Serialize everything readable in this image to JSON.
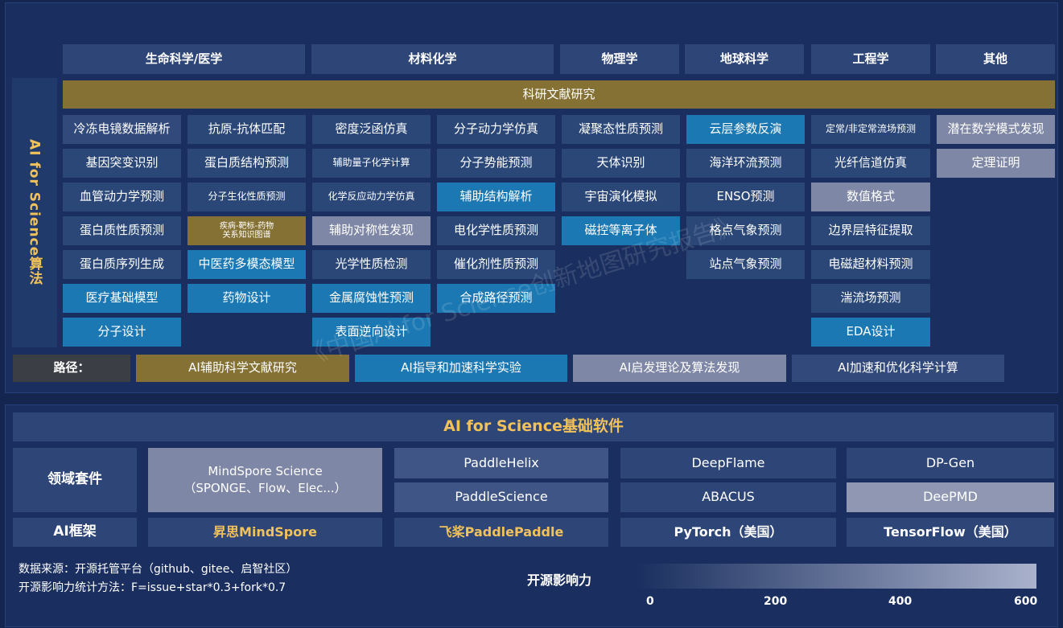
{
  "categories": [
    "生命科学/医学",
    "材料化学",
    "物理学",
    "地球科学",
    "工程学",
    "其他"
  ],
  "literature_bar": "科研文献研究",
  "side_label": "AI for Science算法",
  "grid": [
    [
      "冷冻电镜数据解析",
      "基因突变识别",
      "血管动力学预测",
      "蛋白质性质预测",
      "蛋白质序列生成",
      "医疗基础模型",
      "分子设计"
    ],
    [
      "抗原-抗体匹配",
      "蛋白质结构预测",
      "分子生化性质预测",
      "疾病-靶标-药物\n关系知识图谱",
      "中医药多模态模型",
      "药物设计"
    ],
    [
      "密度泛函仿真",
      "辅助量子化学计算",
      "化学反应动力学仿真",
      "辅助对称性发现",
      "光学性质检测",
      "金属腐蚀性预测",
      "表面逆向设计"
    ],
    [
      "分子动力学仿真",
      "分子势能预测",
      "辅助结构解析",
      "电化学性质预测",
      "催化剂性质预测",
      "合成路径预测"
    ],
    [
      "凝聚态性质预测",
      "天体识别",
      "宇宙演化模拟",
      "磁控等离子体"
    ],
    [
      "云层参数反演",
      "海洋环流预测",
      "ENSO预测",
      "格点气象预测",
      "站点气象预测"
    ],
    [
      "定常/非定常流场预测",
      "光纤信道仿真",
      "数值格式",
      "边界层特征提取",
      "电磁超材料预测",
      "湍流场预测",
      "EDA设计"
    ],
    [
      "潜在数学模式发现",
      "定理证明"
    ]
  ],
  "paths": {
    "label": "路径：",
    "items": [
      "AI辅助科学文献研究",
      "AI指导和加速科学实验",
      "AI启发理论及算法发现",
      "AI加速和优化科学计算"
    ]
  },
  "watermark": "《中国AI for Science创新地图研究报告》",
  "software": {
    "title": "AI for Science基础软件",
    "suite_label": "领域套件",
    "framework_label": "AI框架",
    "mindspore_suite": "MindSpore Science\n（SPONGE、Flow、Elec...）",
    "paddle_suites": [
      "PaddleHelix",
      "PaddleScience"
    ],
    "pytorch_suites": [
      "DeepFlame",
      "ABACUS"
    ],
    "tf_suites": [
      "DP-Gen",
      "DeePMD"
    ],
    "frameworks": [
      "昇思MindSpore",
      "飞桨PaddlePaddle",
      "PyTorch（美国）",
      "TensorFlow（美国）"
    ]
  },
  "notes": {
    "source": "数据来源：开源托管平台（github、gitee、启智社区）",
    "method": "开源影响力统计方法：F=issue+star*0.3+fork*0.7"
  },
  "legend": {
    "title": "开源影响力",
    "ticks": [
      "0",
      "200",
      "400",
      "600"
    ],
    "color_low": "#1a2f5f",
    "color_high": "#aab2cc"
  }
}
